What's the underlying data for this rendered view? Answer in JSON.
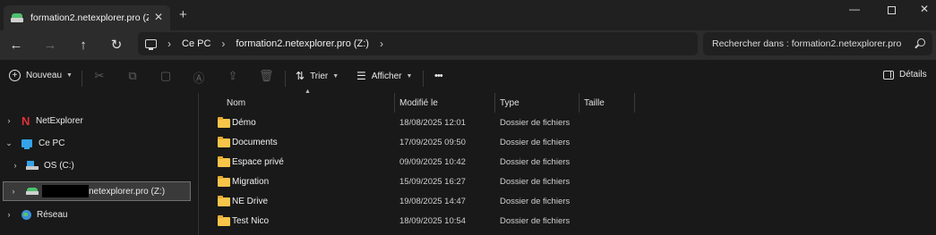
{
  "tab": {
    "title": "formation2.netexplorer.pro (Z:)",
    "close_glyph": "✕",
    "new_tab_glyph": "+"
  },
  "window_controls": {
    "minimize": "—",
    "close": "✕"
  },
  "nav": {
    "back": "←",
    "forward": "→",
    "up": "↑",
    "refresh": "↻"
  },
  "breadcrumb": [
    "Ce PC",
    "formation2.netexplorer.pro (Z:)"
  ],
  "search": {
    "placeholder": "Rechercher dans : formation2.netexplorer.pro"
  },
  "commands": {
    "new_label": "Nouveau",
    "sort_label": "Trier",
    "view_label": "Afficher",
    "more": "•••",
    "details_label": "Détails",
    "disabled_icons": [
      "cut-icon",
      "copy-icon",
      "paste-icon",
      "rename-icon",
      "share-icon",
      "delete-icon"
    ]
  },
  "sidebar": {
    "items": [
      {
        "label": "NetExplorer",
        "chevron": "›",
        "icon": "netexplorer-icon"
      },
      {
        "label": "Ce PC",
        "chevron": "⌄",
        "icon": "pc-icon"
      },
      {
        "label": "OS (C:)",
        "chevron": "›",
        "icon": "os-drive-icon"
      },
      {
        "label": "netexplorer.pro (Z:)",
        "chevron": "›",
        "icon": "network-drive-icon",
        "selected": true
      },
      {
        "label": "Réseau",
        "chevron": "›",
        "icon": "network-icon"
      }
    ]
  },
  "columns": {
    "name": "Nom",
    "modified": "Modifié le",
    "type": "Type",
    "size": "Taille"
  },
  "files": [
    {
      "name": "Démo",
      "modified": "18/08/2025 12:01",
      "type": "Dossier de fichiers"
    },
    {
      "name": "Documents",
      "modified": "17/09/2025 09:50",
      "type": "Dossier de fichiers"
    },
    {
      "name": "Espace privé",
      "modified": "09/09/2025 10:42",
      "type": "Dossier de fichiers"
    },
    {
      "name": "Migration",
      "modified": "15/09/2025 16:27",
      "type": "Dossier de fichiers"
    },
    {
      "name": "NE Drive",
      "modified": "19/08/2025 14:47",
      "type": "Dossier de fichiers"
    },
    {
      "name": "Test Nico",
      "modified": "18/09/2025 10:54",
      "type": "Dossier de fichiers"
    }
  ]
}
